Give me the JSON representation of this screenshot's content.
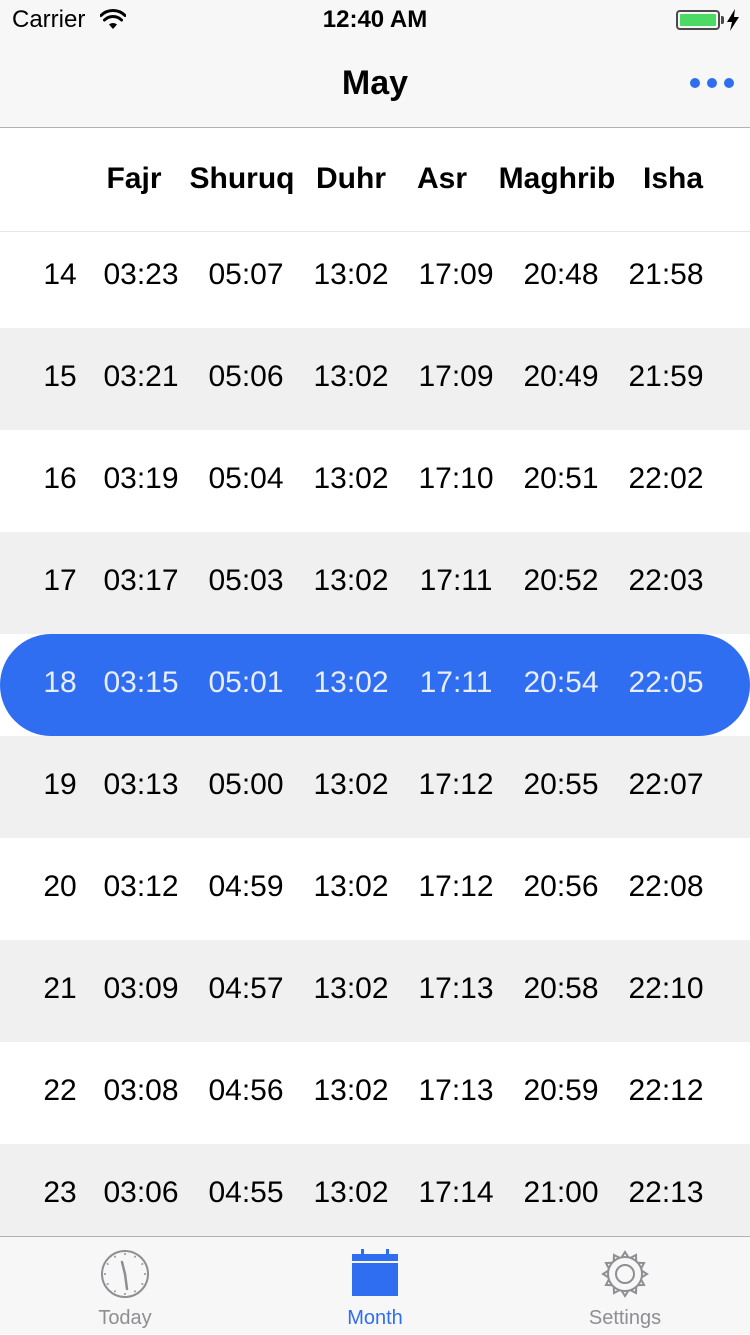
{
  "status_bar": {
    "carrier": "Carrier",
    "time": "12:40 AM"
  },
  "nav": {
    "title": "May",
    "more_icon": "more-dots-icon"
  },
  "colors": {
    "accent": "#2f6ef0",
    "alt_row": "#f0f0f0",
    "battery": "#4cd964"
  },
  "columns": [
    "Fajr",
    "Shuruq",
    "Duhr",
    "Asr",
    "Maghrib",
    "Isha"
  ],
  "rows": [
    {
      "day": "14",
      "times": [
        "03:23",
        "05:07",
        "13:02",
        "17:09",
        "20:48",
        "21:58"
      ]
    },
    {
      "day": "15",
      "times": [
        "03:21",
        "05:06",
        "13:02",
        "17:09",
        "20:49",
        "21:59"
      ]
    },
    {
      "day": "16",
      "times": [
        "03:19",
        "05:04",
        "13:02",
        "17:10",
        "20:51",
        "22:02"
      ]
    },
    {
      "day": "17",
      "times": [
        "03:17",
        "05:03",
        "13:02",
        "17:11",
        "20:52",
        "22:03"
      ]
    },
    {
      "day": "18",
      "times": [
        "03:15",
        "05:01",
        "13:02",
        "17:11",
        "20:54",
        "22:05"
      ],
      "selected": true
    },
    {
      "day": "19",
      "times": [
        "03:13",
        "05:00",
        "13:02",
        "17:12",
        "20:55",
        "22:07"
      ]
    },
    {
      "day": "20",
      "times": [
        "03:12",
        "04:59",
        "13:02",
        "17:12",
        "20:56",
        "22:08"
      ]
    },
    {
      "day": "21",
      "times": [
        "03:09",
        "04:57",
        "13:02",
        "17:13",
        "20:58",
        "22:10"
      ]
    },
    {
      "day": "22",
      "times": [
        "03:08",
        "04:56",
        "13:02",
        "17:13",
        "20:59",
        "22:12"
      ]
    },
    {
      "day": "23",
      "times": [
        "03:06",
        "04:55",
        "13:02",
        "17:14",
        "21:00",
        "22:13"
      ]
    }
  ],
  "tabs": [
    {
      "label": "Today",
      "icon": "clock-icon",
      "active": false
    },
    {
      "label": "Month",
      "icon": "calendar-icon",
      "active": true
    },
    {
      "label": "Settings",
      "icon": "gear-icon",
      "active": false
    }
  ]
}
